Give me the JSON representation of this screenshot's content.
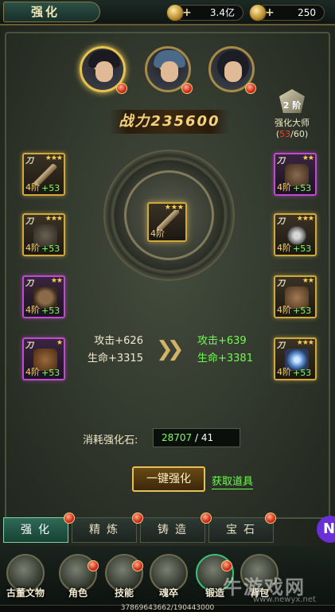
{
  "header": {
    "title": "强化",
    "currency1": "3.4亿",
    "currency2": "250"
  },
  "power": {
    "label": "战力",
    "value": "235600"
  },
  "master": {
    "level": "2 阶",
    "name": "强化大师",
    "current": "53",
    "total": "/60)",
    "open": "("
  },
  "slots": {
    "left": [
      {
        "stars": "★★★",
        "level": "4阶",
        "bonus": "+53",
        "quality": "gold",
        "icon": "staff-icon"
      },
      {
        "stars": "★★★",
        "level": "4阶",
        "bonus": "+53",
        "quality": "gold",
        "icon": "armor-icon"
      },
      {
        "stars": "★★",
        "level": "4阶",
        "bonus": "+53",
        "quality": "purple",
        "icon": "belt-icon"
      },
      {
        "stars": "★",
        "level": "4阶",
        "bonus": "+53",
        "quality": "purple",
        "icon": "glove-icon"
      }
    ],
    "right": [
      {
        "stars": "★★",
        "level": "4阶",
        "bonus": "+53",
        "quality": "purple",
        "icon": "helmet-icon"
      },
      {
        "stars": "★★★",
        "level": "4阶",
        "bonus": "+53",
        "quality": "gold",
        "icon": "necklace-icon"
      },
      {
        "stars": "★★",
        "level": "4阶",
        "bonus": "+53",
        "quality": "gold",
        "icon": "boots-icon"
      },
      {
        "stars": "★★★",
        "level": "4阶",
        "bonus": "+53",
        "quality": "gold",
        "icon": "ring-icon"
      }
    ],
    "knife": "刀"
  },
  "center": {
    "stars": "★★★",
    "level": "4阶"
  },
  "stats": {
    "cur_atk": "攻击+626",
    "cur_hp": "生命+3315",
    "next_atk": "攻击+639",
    "next_hp": "生命+3381"
  },
  "cost": {
    "label": "消耗强化石:",
    "have": "28707",
    "need": " / 41"
  },
  "buttons": {
    "oneclick": "一键强化",
    "get": "获取道具"
  },
  "tabs": [
    "强化",
    "精炼",
    "铸造",
    "宝石"
  ],
  "nav": [
    "古董文物",
    "角色",
    "技能",
    "魂卒",
    "锻造",
    "背包"
  ],
  "float_badge": "N",
  "exp": "37869643662/190443000",
  "watermark": {
    "main": "牛游戏网",
    "sub": "www.newyx.net"
  }
}
